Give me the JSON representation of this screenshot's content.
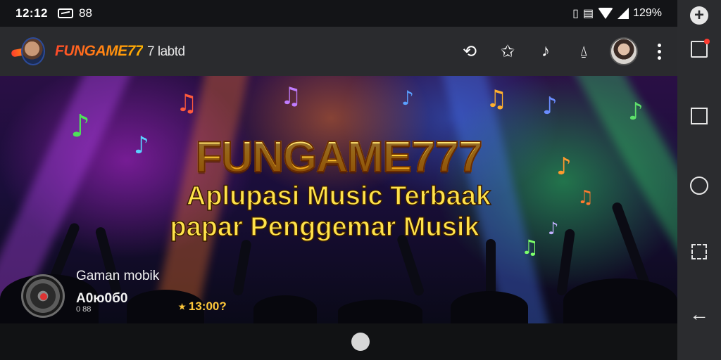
{
  "status_bar": {
    "time": "12:12",
    "notif_badge": "88",
    "battery_pct": "129%",
    "icons": [
      "notification-icon",
      "vibrate-icon",
      "nfc-icon",
      "wifi-icon",
      "signal-icon"
    ]
  },
  "app_bar": {
    "brand": "FUNGAME77",
    "brand_suffix": "7 labtd",
    "icons": [
      "share-icon",
      "star-icon",
      "music-note-icon",
      "notification-icon"
    ]
  },
  "banner": {
    "title": "FUNGAME777",
    "subtitle_line1": "Aplupasi Music Terbaak",
    "subtitle_line2": "papar Penggemar Musik"
  },
  "game": {
    "name": "Gaman mobik",
    "developer": "A0ю0б0",
    "developer_sub": "0 88",
    "stat": "⭑ 13:00?"
  },
  "nav_rail": {
    "icons": [
      "add-icon",
      "edit-icon",
      "square-icon",
      "circle-icon",
      "rotate-icon",
      "back-icon"
    ]
  },
  "colors": {
    "accent_gold": "#ffd23a",
    "brand_orange": "#ff4a2a",
    "appbar_bg": "#2a2b2e",
    "rail_bg": "#2b2c2f"
  }
}
